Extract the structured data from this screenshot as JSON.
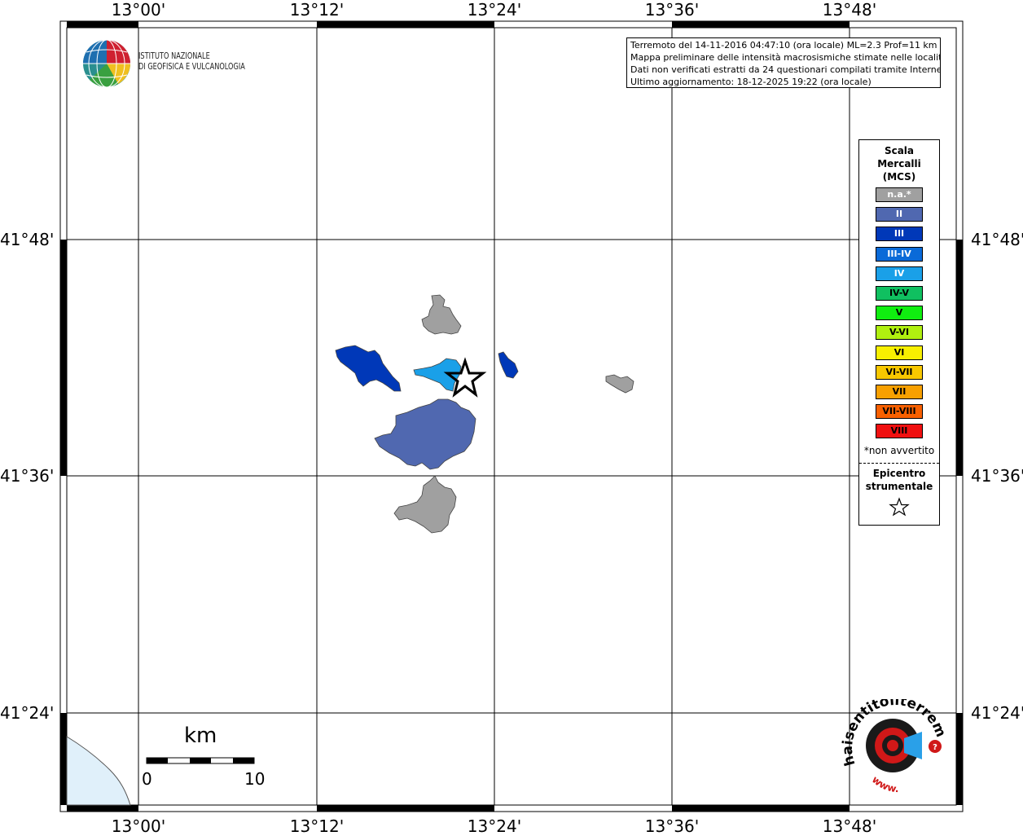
{
  "map": {
    "longitude_labels": [
      "13°00'",
      "13°12'",
      "13°24'",
      "13°36'",
      "13°48'"
    ],
    "latitude_labels": [
      "41°48'",
      "41°36'",
      "41°24'"
    ]
  },
  "info_box": {
    "line1": "Terremoto del 14-11-2016 04:47:10 (ora locale) ML=2.3 Prof=11 km",
    "line2": "Mappa preliminare delle intensità macrosismiche stimate nelle località",
    "line3": "Dati non verificati estratti da 24 questionari compilati tramite Internet.",
    "line4": "Ultimo aggiornamento: 18-12-2025 19:22 (ora locale)"
  },
  "logo": {
    "line1": "ISTITUTO NAZIONALE",
    "line2": "DI GEOFISICA E VULCANOLOGIA"
  },
  "legend": {
    "title_line1": "Scala",
    "title_line2": "Mercalli",
    "title_line3": "(MCS)",
    "items": [
      {
        "label": "n.a.*",
        "color": "#a0a0a0",
        "text_color": "#ffffff"
      },
      {
        "label": "II",
        "color": "#5068b0",
        "text_color": "#ffffff"
      },
      {
        "label": "III",
        "color": "#0038b8",
        "text_color": "#ffffff"
      },
      {
        "label": "III-IV",
        "color": "#0a6ad8",
        "text_color": "#ffffff"
      },
      {
        "label": "IV",
        "color": "#1aa0e8",
        "text_color": "#ffffff"
      },
      {
        "label": "IV-V",
        "color": "#10c060",
        "text_color": "#000000"
      },
      {
        "label": "V",
        "color": "#10ee10",
        "text_color": "#000000"
      },
      {
        "label": "V-VI",
        "color": "#b0f010",
        "text_color": "#000000"
      },
      {
        "label": "VI",
        "color": "#f8f000",
        "text_color": "#000000"
      },
      {
        "label": "VI-VII",
        "color": "#f8c800",
        "text_color": "#000000"
      },
      {
        "label": "VII",
        "color": "#f8a000",
        "text_color": "#000000"
      },
      {
        "label": "VII-VIII",
        "color": "#f86000",
        "text_color": "#000000"
      },
      {
        "label": "VIII",
        "color": "#f01010",
        "text_color": "#000000"
      }
    ],
    "note": "*non avvertito",
    "epicenter_line1": "Epicentro",
    "epicenter_line2": "strumentale"
  },
  "scale_bar": {
    "unit": "km",
    "start": "0",
    "end": "10"
  },
  "haisentito_logo": {
    "text": "haisentitoilterremoto.it",
    "url_text": "www."
  },
  "colors": {
    "gray_area": "#a0a0a0",
    "intensity_II": "#5068b0",
    "intensity_III": "#0038b8",
    "intensity_IV": "#1aa0e8",
    "sea": "#e0f0fa"
  }
}
